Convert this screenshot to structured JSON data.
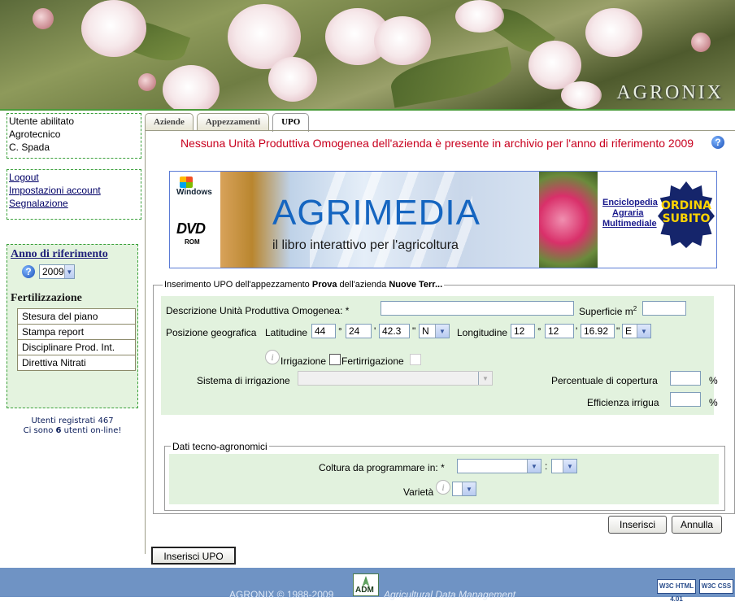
{
  "header": {
    "title": "AGRONIX"
  },
  "sidebar": {
    "user": {
      "line1": "Utente abilitato",
      "line2": "Agrotecnico",
      "line3": "C. Spada"
    },
    "links": [
      "Logout",
      "Impostazioni account",
      "Segnalazione"
    ],
    "year": {
      "title": "Anno di riferimento",
      "selected": "2009"
    },
    "fert": {
      "title": "Fertilizzazione",
      "items": [
        "Stesura del piano",
        "Stampa report",
        "Disciplinare Prod. Int.",
        "Direttiva Nitrati"
      ]
    },
    "users_registered": "Utenti registrati 467",
    "online_prefix": "Ci sono ",
    "online_count": "6",
    "online_suffix": " utenti on-line!"
  },
  "tabs": [
    "Aziende",
    "Appezzamenti",
    "UPO"
  ],
  "message": "Nessuna Unità Produttiva Omogenea dell'azienda è presente in archivio per l'anno di riferimento 2009",
  "ad": {
    "windows": "Windows",
    "dvd": "DVD",
    "rom": "ROM",
    "title": "AGRIMEDIA",
    "subtitle": "il libro interattivo per l'agricoltura",
    "enc1": "Enciclopedia",
    "enc2": "Agraria",
    "enc3": "Multimediale",
    "order1": "ORDINA",
    "order2": "SUBITO"
  },
  "upo": {
    "legend_prefix": "Inserimento UPO dell'appezzamento ",
    "legend_field": "Prova",
    "legend_mid": " dell'azienda ",
    "legend_company": "Nuove Terr...",
    "desc_label": "Descrizione Unità Produttiva Omogenea: *",
    "desc_value": "",
    "surface_label": "Superficie m",
    "surface_sup": "2",
    "surface_value": "",
    "pos_label": "Posizione geografica",
    "lat_label": "Latitudine",
    "lat_deg": "44",
    "lat_min": "24",
    "lat_sec": "42.3",
    "lat_dir": "N",
    "lon_label": "Longitudine",
    "lon_deg": "12",
    "lon_min": "12",
    "lon_sec": "16.92",
    "lon_dir": "E",
    "deg_sym": "°",
    "min_sym": "'",
    "sec_sym": "\"",
    "irr_label": "Irrigazione",
    "fertirr_label": "Fertirrigazione",
    "irr_system_label": "Sistema di irrigazione",
    "coverage_label": "Percentuale di copertura",
    "efficiency_label": "Efficienza irrigua",
    "percent": "%"
  },
  "tecno": {
    "legend": "Dati tecno-agronomici",
    "crop_label": "Coltura da programmare in: *",
    "colon": ":",
    "variety_label": "Varietà"
  },
  "buttons": {
    "insert": "Inserisci",
    "cancel": "Annulla",
    "insert_upo": "Inserisci UPO"
  },
  "footer": {
    "copyright": "AGRONIX   © 1988-2009",
    "logo": "ADM",
    "tagline": "Agricultural Data Management",
    "w3c_html": "W3C HTML 4.01",
    "w3c_css": "W3C CSS"
  }
}
